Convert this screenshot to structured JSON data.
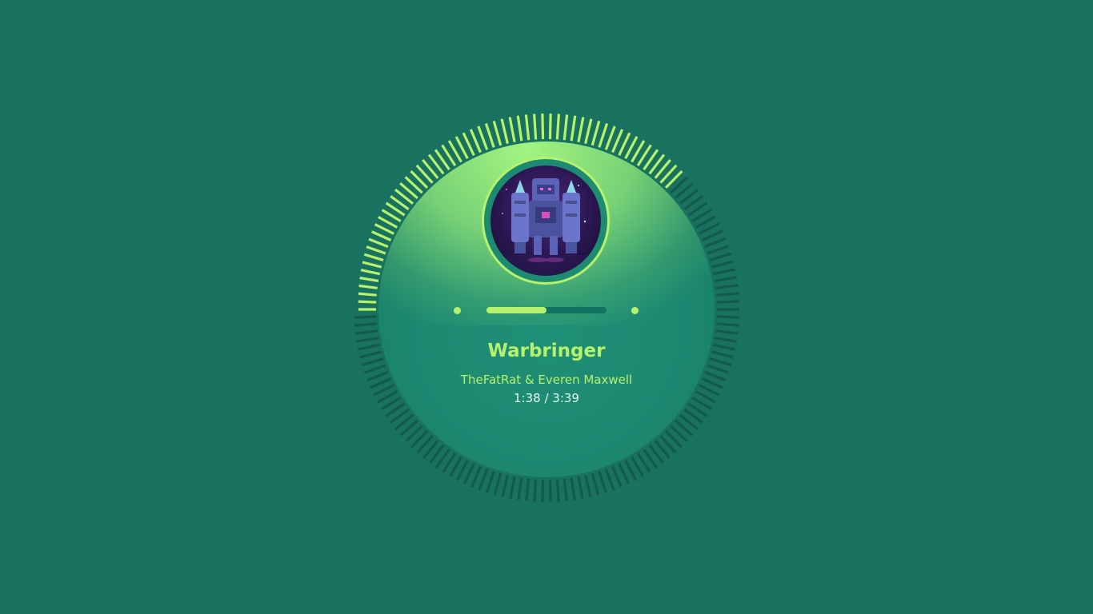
{
  "player": {
    "track_title": "Warbringer",
    "artist": "TheFatRat & Everen Maxwell",
    "time_display": "1:38 / 3:39",
    "progress_fraction": 0.5,
    "visualizer_active_fraction": 0.38
  },
  "colors": {
    "background": "#19715f",
    "accent": "#b6f26c",
    "disc": "#1f8f76",
    "tick_inactive": "#135a4b",
    "track": "#147260",
    "time_text": "#e6f5ef"
  },
  "icons": {
    "album_art": "robot-mech-artwork",
    "prev": "dot-icon",
    "next": "dot-icon"
  }
}
